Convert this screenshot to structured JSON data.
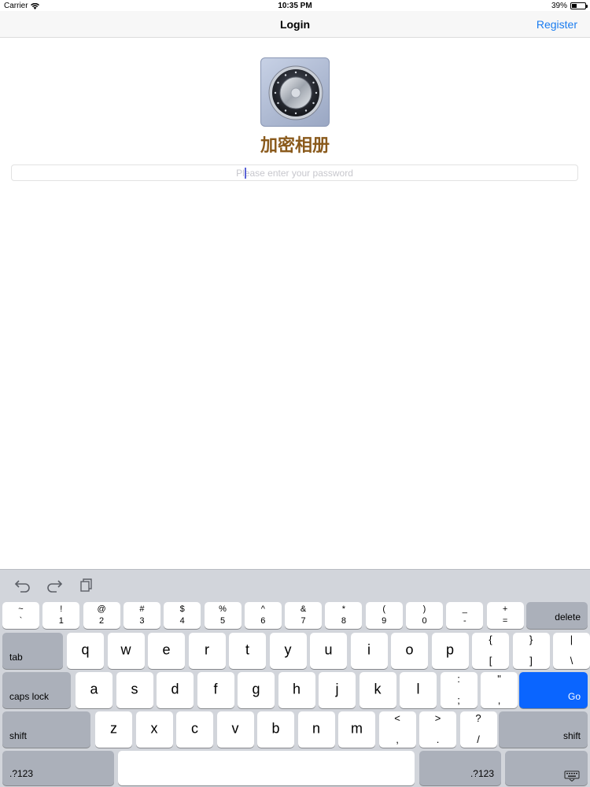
{
  "status_bar": {
    "carrier": "Carrier",
    "time": "10:35 PM",
    "battery": "39%",
    "battery_level": 0.39
  },
  "nav": {
    "title": "Login",
    "register": "Register"
  },
  "content": {
    "app_name": "加密相册",
    "password_placeholder": "Please enter your password",
    "password_value": ""
  },
  "keyboard": {
    "toolbar": [
      "undo-icon",
      "redo-icon",
      "paste-icon"
    ],
    "row1": [
      {
        "top": "~",
        "bot": "`"
      },
      {
        "top": "!",
        "bot": "1"
      },
      {
        "top": "@",
        "bot": "2"
      },
      {
        "top": "#",
        "bot": "3"
      },
      {
        "top": "$",
        "bot": "4"
      },
      {
        "top": "%",
        "bot": "5"
      },
      {
        "top": "^",
        "bot": "6"
      },
      {
        "top": "&",
        "bot": "7"
      },
      {
        "top": "*",
        "bot": "8"
      },
      {
        "top": "(",
        "bot": "9"
      },
      {
        "top": ")",
        "bot": "0"
      },
      {
        "top": "_",
        "bot": "-"
      },
      {
        "top": "+",
        "bot": "="
      }
    ],
    "delete": "delete",
    "tab": "tab",
    "row2": [
      "q",
      "w",
      "e",
      "r",
      "t",
      "y",
      "u",
      "i",
      "o",
      "p"
    ],
    "row2_sym": [
      {
        "top": "{",
        "bot": "["
      },
      {
        "top": "}",
        "bot": "]"
      },
      {
        "top": "|",
        "bot": "\\"
      }
    ],
    "caps_lock": "caps lock",
    "row3": [
      "a",
      "s",
      "d",
      "f",
      "g",
      "h",
      "j",
      "k",
      "l"
    ],
    "row3_sym": [
      {
        "top": ":",
        "bot": ";"
      },
      {
        "top": "\"",
        "bot": ","
      }
    ],
    "go": "Go",
    "shift": "shift",
    "row4": [
      "z",
      "x",
      "c",
      "v",
      "b",
      "n",
      "m"
    ],
    "row4_sym": [
      {
        "top": "<",
        "bot": ","
      },
      {
        "top": ">",
        "bot": "."
      },
      {
        "top": "?",
        "bot": "/"
      }
    ],
    "numbers": ".?123",
    "dismiss_icon": "keyboard-dismiss-icon"
  }
}
